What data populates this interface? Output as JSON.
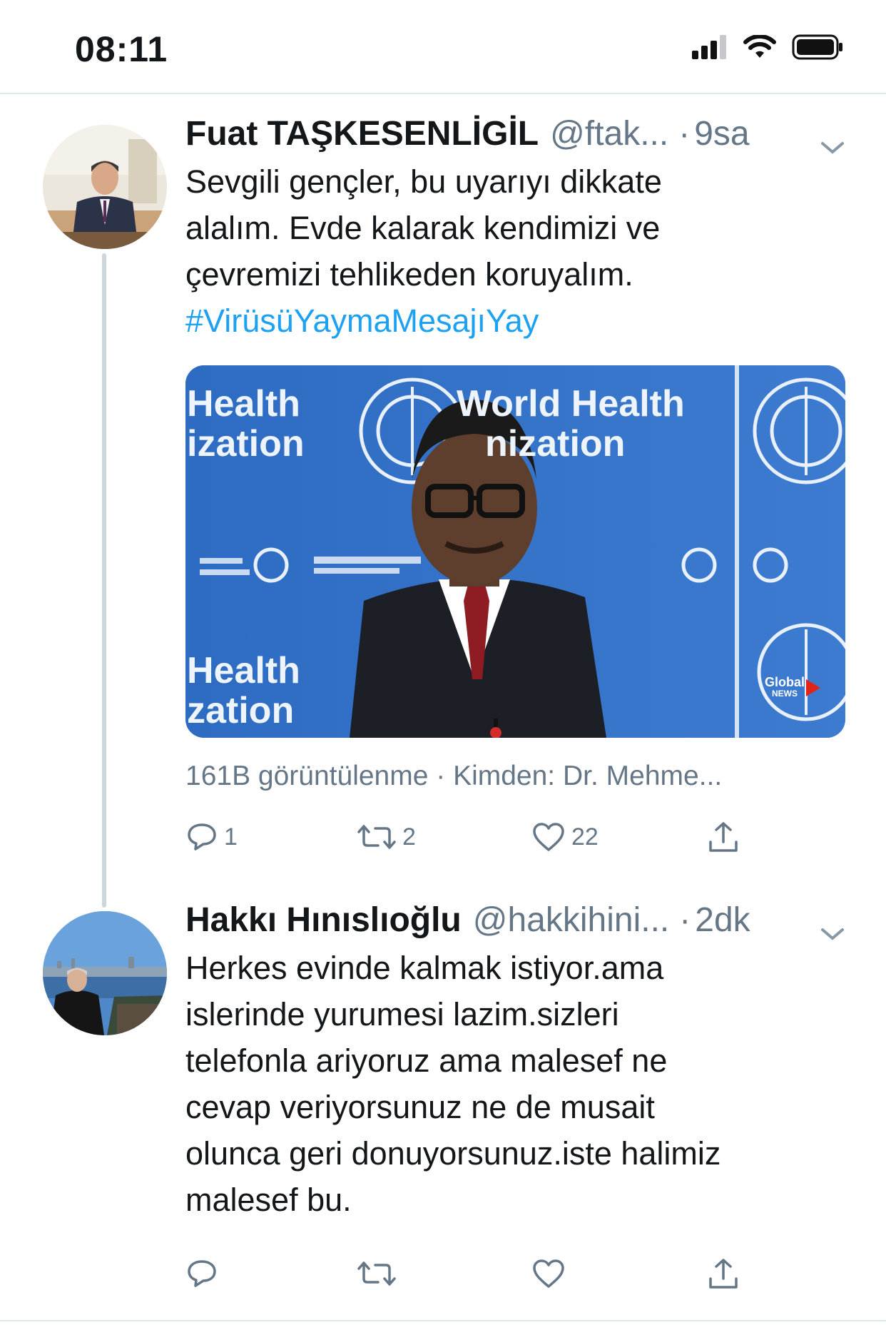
{
  "status_bar": {
    "time": "08:11"
  },
  "tweets": [
    {
      "name": "Fuat TAŞKESENLİGİL",
      "handle": "@ftak...",
      "dot": "·",
      "time": "9sa",
      "text_lines": [
        "Sevgili gençler, bu uyarıyı dikkate",
        "alalım. Evde kalarak kendimizi ve",
        "çevremizi tehlikeden koruyalım."
      ],
      "hashtag": "#VirüsüYaymaMesajıYay",
      "media": {
        "backdrop_left_top": "Health",
        "backdrop_left_bottom": "ization",
        "backdrop_center_top": "World Health",
        "backdrop_center_bottom": "nization",
        "backdrop_lower_top": "Health",
        "backdrop_lower_bottom": "zation",
        "badge_top": "Global",
        "badge_bottom": "NEWS"
      },
      "meta": "161B görüntülenme · Kimden: Dr. Mehme...",
      "counts": {
        "reply": "1",
        "retweet": "2",
        "like": "22"
      }
    },
    {
      "name": "Hakkı Hınıslıoğlu",
      "handle": "@hakkihini...",
      "dot": "·",
      "time": "2dk",
      "text_lines": [
        "Herkes evinde kalmak istiyor.ama",
        "islerinde yurumesi lazim.sizleri",
        "telefonla ariyoruz ama malesef ne",
        "cevap veriyorsunuz ne de musait",
        "olunca geri donuyorsunuz.iste halimiz",
        "malesef bu."
      ],
      "counts": {
        "reply": "",
        "retweet": "",
        "like": ""
      }
    }
  ],
  "icons": {
    "signal": "signal-bars-icon",
    "wifi": "wifi-icon",
    "battery": "battery-icon",
    "caret": "chevron-down-icon",
    "reply": "reply-icon",
    "retweet": "retweet-icon",
    "like": "heart-icon",
    "share": "share-icon"
  },
  "colors": {
    "link": "#1da1f2",
    "muted": "#657786",
    "text": "#14171a",
    "divider": "#e1e8ed"
  }
}
